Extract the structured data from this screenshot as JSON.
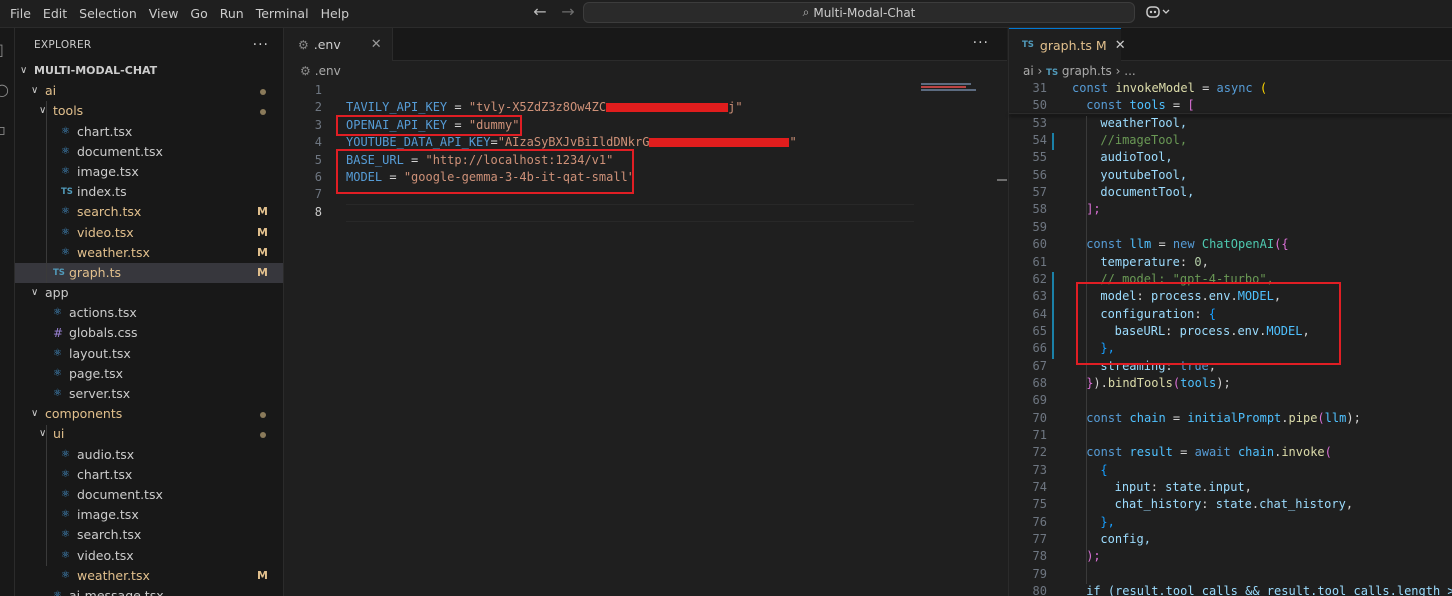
{
  "menu": [
    "File",
    "Edit",
    "Selection",
    "View",
    "Go",
    "Run",
    "Terminal",
    "Help"
  ],
  "search": {
    "text": "Multi-Modal-Chat"
  },
  "explorer": {
    "title": "EXPLORER",
    "root": "MULTI-MODAL-CHAT",
    "items": [
      {
        "label": "ai",
        "type": "folder",
        "depth": 1,
        "status": "dot"
      },
      {
        "label": "tools",
        "type": "folder",
        "depth": 2,
        "status": "dot"
      },
      {
        "label": "chart.tsx",
        "type": "react",
        "depth": 3,
        "status": ""
      },
      {
        "label": "document.tsx",
        "type": "react",
        "depth": 3,
        "status": ""
      },
      {
        "label": "image.tsx",
        "type": "react",
        "depth": 3,
        "status": ""
      },
      {
        "label": "index.ts",
        "type": "ts",
        "depth": 3,
        "status": ""
      },
      {
        "label": "search.tsx",
        "type": "react",
        "depth": 3,
        "status": "M"
      },
      {
        "label": "video.tsx",
        "type": "react",
        "depth": 3,
        "status": "M"
      },
      {
        "label": "weather.tsx",
        "type": "react",
        "depth": 3,
        "status": "M"
      },
      {
        "label": "graph.ts",
        "type": "ts",
        "depth": 2,
        "status": "M",
        "selected": true
      },
      {
        "label": "app",
        "type": "folder",
        "depth": 1,
        "status": ""
      },
      {
        "label": "actions.tsx",
        "type": "react",
        "depth": 2,
        "status": ""
      },
      {
        "label": "globals.css",
        "type": "css",
        "depth": 2,
        "status": ""
      },
      {
        "label": "layout.tsx",
        "type": "react",
        "depth": 2,
        "status": ""
      },
      {
        "label": "page.tsx",
        "type": "react",
        "depth": 2,
        "status": ""
      },
      {
        "label": "server.tsx",
        "type": "react",
        "depth": 2,
        "status": ""
      },
      {
        "label": "components",
        "type": "folder",
        "depth": 1,
        "status": "dot"
      },
      {
        "label": "ui",
        "type": "folder",
        "depth": 2,
        "status": "dot"
      },
      {
        "label": "audio.tsx",
        "type": "react",
        "depth": 3,
        "status": ""
      },
      {
        "label": "chart.tsx",
        "type": "react",
        "depth": 3,
        "status": ""
      },
      {
        "label": "document.tsx",
        "type": "react",
        "depth": 3,
        "status": ""
      },
      {
        "label": "image.tsx",
        "type": "react",
        "depth": 3,
        "status": ""
      },
      {
        "label": "search.tsx",
        "type": "react",
        "depth": 3,
        "status": ""
      },
      {
        "label": "video.tsx",
        "type": "react",
        "depth": 3,
        "status": ""
      },
      {
        "label": "weather.tsx",
        "type": "react",
        "depth": 3,
        "status": "M"
      },
      {
        "label": "ai-message.tsx",
        "type": "react",
        "depth": 2,
        "status": ""
      }
    ]
  },
  "env_editor": {
    "tab_label": ".env",
    "breadcrumb": ".env",
    "line_numbers": [
      "1",
      "2",
      "3",
      "4",
      "5",
      "6",
      "7",
      "8"
    ],
    "lines": [
      {
        "key": "",
        "op": "",
        "val": ""
      },
      {
        "key": "TAVILY_API_KEY",
        "op": " = ",
        "val": "\"tvly-X5ZdZ3z8Ow4ZC",
        "redacted": true,
        "tail": "j\""
      },
      {
        "key": "OPENAI_API_KEY",
        "op": " = ",
        "val": "\"dummy\""
      },
      {
        "key": "YOUTUBE_DATA_API_KEY",
        "op": "=",
        "val": "\"AIzaSyBXJvBiIldDNkrG",
        "redacted": true,
        "tail": "\""
      },
      {
        "key": "BASE_URL",
        "op": " = ",
        "val": "\"http://localhost:1234/v1\""
      },
      {
        "key": "MODEL",
        "op": " = ",
        "val": "\"google-gemma-3-4b-it-qat-small\""
      },
      {
        "key": "",
        "op": "",
        "val": ""
      },
      {
        "key": "",
        "op": "",
        "val": ""
      }
    ]
  },
  "graph_editor": {
    "tab_label": "graph.ts",
    "tab_status": "M",
    "breadcrumb": [
      "ai",
      "graph.ts",
      "..."
    ],
    "line_numbers": [
      "31",
      "50",
      "53",
      "54",
      "55",
      "56",
      "57",
      "58",
      "59",
      "60",
      "61",
      "62",
      "63",
      "64",
      "65",
      "66",
      "67",
      "68",
      "69",
      "70",
      "71",
      "72",
      "73",
      "74",
      "75",
      "76",
      "77",
      "78",
      "79",
      "80"
    ],
    "sticky_31": [
      "const",
      "invokeModel",
      "=",
      "async",
      "("
    ],
    "sticky_50": [
      "const",
      "tools",
      "=",
      "["
    ],
    "tools_list": [
      "weatherTool,",
      "//imageTool,",
      "audioTool,",
      "youtubeTool,",
      "documentTool,"
    ],
    "llm": {
      "decl": [
        "const",
        "llm",
        "=",
        "new",
        "ChatOpenAI",
        "({"
      ],
      "temperature": [
        "temperature",
        ": ",
        "0",
        ","
      ],
      "model_comment": "// model: \"gpt-4-turbo\",",
      "model": [
        "model",
        ": ",
        "process",
        ".",
        "env",
        ".",
        "MODEL",
        ","
      ],
      "configuration": [
        "configuration",
        ": ",
        "{"
      ],
      "baseURL": [
        "baseURL",
        ": ",
        "process",
        ".",
        "env",
        ".",
        "MODEL",
        ","
      ],
      "close_conf": "},",
      "streaming": [
        "streaming",
        ": ",
        "true",
        ","
      ],
      "bind": [
        "}",
        ").",
        "bindTools",
        "(",
        "tools",
        ");"
      ]
    },
    "chain": [
      "const",
      "chain",
      "=",
      "initialPrompt",
      ".",
      "pipe",
      "(",
      "llm",
      ");"
    ],
    "result": [
      "const",
      "result",
      "=",
      "await",
      "chain",
      ".",
      "invoke",
      "("
    ],
    "brace_open": "{",
    "input_line": [
      "input",
      ": ",
      "state",
      ".",
      "input",
      ","
    ],
    "history_line": [
      "chat_history",
      ": ",
      "state",
      ".",
      "chat_history",
      ","
    ],
    "brace_close": "},",
    "config_line": "config,",
    "paren_close": ");",
    "if_line": "if (result.tool_calls && result.tool_calls.length >"
  },
  "colors": {
    "accent": "#0078d4",
    "highlight_box": "#e01e24",
    "modified": "#e2c08d"
  }
}
